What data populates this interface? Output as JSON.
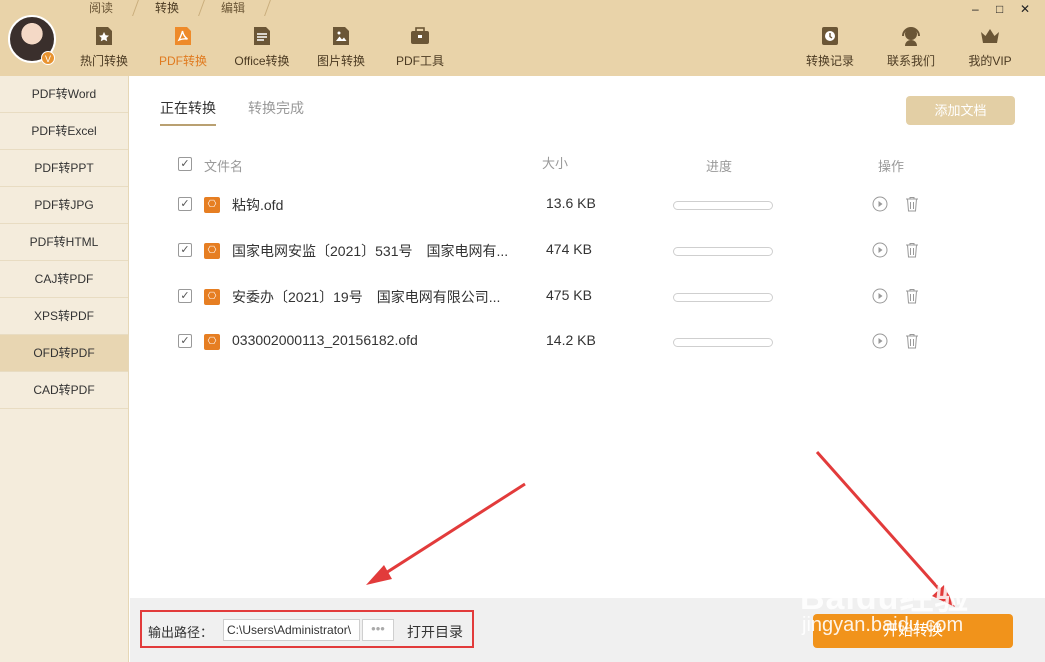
{
  "header": {
    "mode_tabs": [
      "阅读",
      "转换",
      "编辑"
    ],
    "active_mode": 1,
    "avatar_badge": "V",
    "tools": [
      {
        "label": "热门转换",
        "icon": "star-doc-icon"
      },
      {
        "label": "PDF转换",
        "icon": "pdf-icon"
      },
      {
        "label": "Office转换",
        "icon": "office-doc-icon"
      },
      {
        "label": "图片转换",
        "icon": "image-doc-icon"
      },
      {
        "label": "PDF工具",
        "icon": "toolbox-icon"
      }
    ],
    "right_tools": [
      {
        "label": "转换记录",
        "icon": "clock-icon"
      },
      {
        "label": "联系我们",
        "icon": "headset-icon"
      },
      {
        "label": "我的VIP",
        "icon": "crown-icon"
      }
    ],
    "window_controls": [
      "–",
      "□",
      "✕"
    ]
  },
  "sidebar": {
    "items": [
      "PDF转Word",
      "PDF转Excel",
      "PDF转PPT",
      "PDF转JPG",
      "PDF转HTML",
      "CAJ转PDF",
      "XPS转PDF",
      "OFD转PDF",
      "CAD转PDF"
    ],
    "active_index": 7
  },
  "main": {
    "tabs": [
      "正在转换",
      "转换完成"
    ],
    "add_button": "添加文档",
    "columns": {
      "name": "文件名",
      "size": "大小",
      "progress": "进度",
      "actions": "操作"
    },
    "files": [
      {
        "name": "粘钩.ofd",
        "size": "13.6 KB",
        "progress": 0
      },
      {
        "name": "国家电网安监〔2021〕531号　国家电网有...",
        "size": "474 KB",
        "progress": 0
      },
      {
        "name": "安委办〔2021〕19号　国家电网有限公司...",
        "size": "475 KB",
        "progress": 0
      },
      {
        "name": "033002000113_20156182.ofd",
        "size": "14.2 KB",
        "progress": 0
      }
    ]
  },
  "bottom": {
    "path_label": "输出路径：",
    "path_value": "C:\\Users\\Administrator\\",
    "more": "•••",
    "open_dir": "打开目录",
    "start_button": "开始转换"
  },
  "watermark": {
    "line1": "Baidu经验",
    "line2": "jingyan.baidu.com"
  },
  "colors": {
    "accent": "#f1931b",
    "header_bg": "#e9d3a9",
    "highlight": "#e23b3b"
  }
}
